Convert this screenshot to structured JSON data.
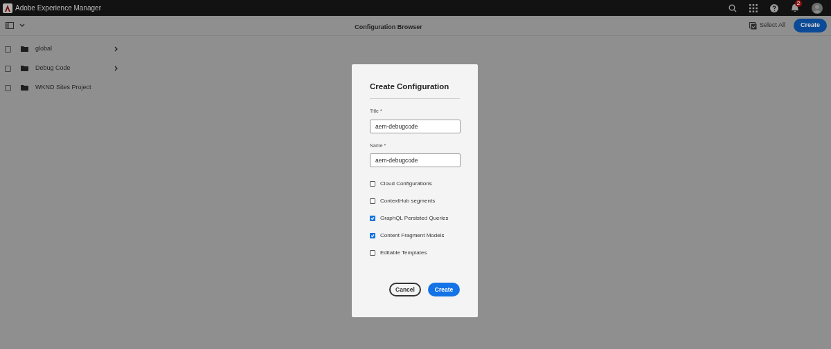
{
  "app_bar": {
    "title": "Adobe Experience Manager",
    "notification_count": "2"
  },
  "toolbar": {
    "title": "Configuration Browser",
    "select_all": "Select All",
    "create": "Create"
  },
  "items": [
    {
      "label": "global",
      "has_children": true,
      "checked": false
    },
    {
      "label": "Debug Code",
      "has_children": true,
      "checked": false
    },
    {
      "label": "WKND Sites Project",
      "has_children": false,
      "checked": false
    }
  ],
  "dialog": {
    "title": "Create Configuration",
    "fields": [
      {
        "label": "Title *",
        "value": "aem-debugcode"
      },
      {
        "label": "Name *",
        "value": "aem-debugcode"
      }
    ],
    "options": [
      {
        "label": "Cloud Configurations",
        "checked": false
      },
      {
        "label": "ContextHub segments",
        "checked": false
      },
      {
        "label": "GraphQL Persisted Queries",
        "checked": true
      },
      {
        "label": "Content Fragment Models",
        "checked": true
      },
      {
        "label": "Editable Templates",
        "checked": false
      }
    ],
    "cancel": "Cancel",
    "confirm": "Create"
  }
}
